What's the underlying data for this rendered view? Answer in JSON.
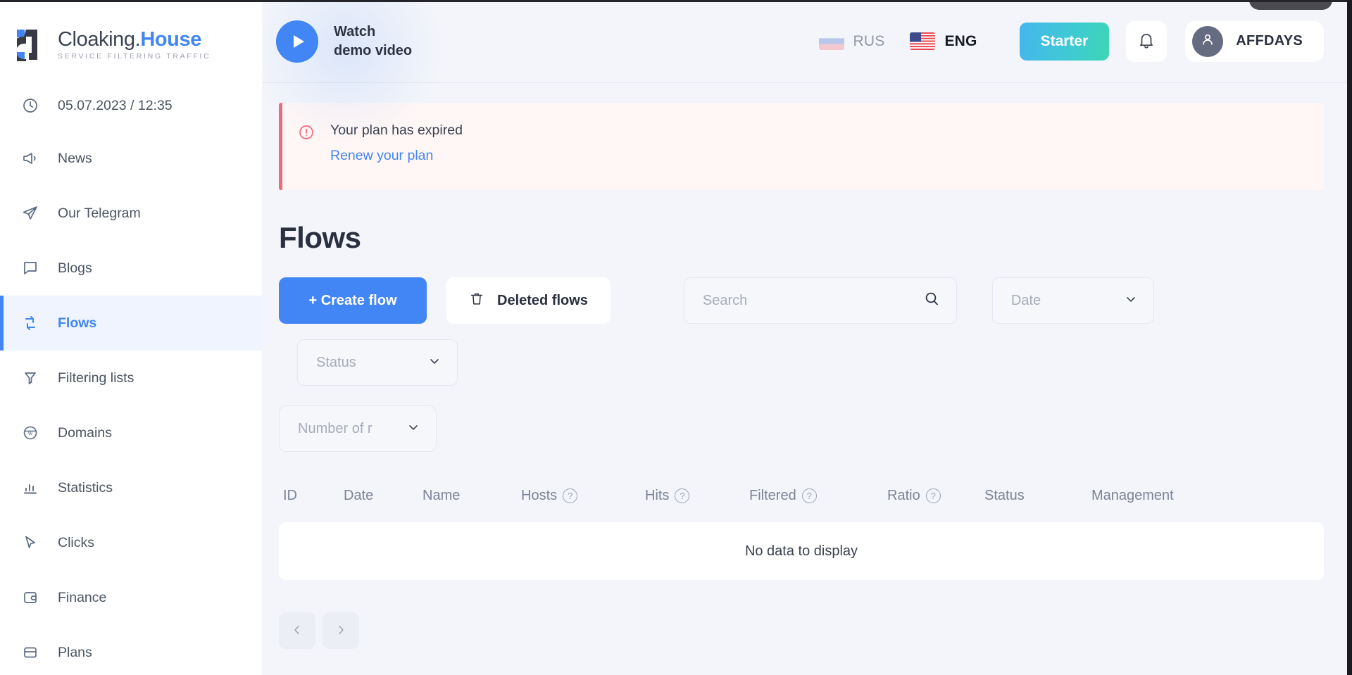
{
  "brand": {
    "name_dark": "Cloaking.",
    "name_accent": "House",
    "tagline": "SERVICE FILTERING TRAFFIC"
  },
  "sidebar": {
    "items": [
      {
        "label": "05.07.2023 / 12:35",
        "icon": "clock-icon",
        "key": "datetime",
        "active": false
      },
      {
        "label": "News",
        "icon": "megaphone-icon",
        "key": "news",
        "active": false
      },
      {
        "label": "Our Telegram",
        "icon": "send-icon",
        "key": "our-telegram",
        "active": false
      },
      {
        "label": "Blogs",
        "icon": "message-icon",
        "key": "blogs",
        "active": false
      },
      {
        "label": "Flows",
        "icon": "refresh-icon",
        "key": "flows",
        "active": true
      },
      {
        "label": "Filtering lists",
        "icon": "filter-icon",
        "key": "filtering-lists",
        "active": false
      },
      {
        "label": "Domains",
        "icon": "globe-icon",
        "key": "domains",
        "active": false
      },
      {
        "label": "Statistics",
        "icon": "bar-chart-icon",
        "key": "statistics",
        "active": false
      },
      {
        "label": "Clicks",
        "icon": "cursor-icon",
        "key": "clicks",
        "active": false
      },
      {
        "label": "Finance",
        "icon": "wallet-icon",
        "key": "finance",
        "active": false
      },
      {
        "label": "Plans",
        "icon": "card-icon",
        "key": "plans",
        "active": false
      }
    ]
  },
  "header": {
    "watch_line1": "Watch",
    "watch_line2": "demo video",
    "languages": [
      {
        "code": "RUS",
        "flag": "flag-ru",
        "active": false
      },
      {
        "code": "ENG",
        "flag": "flag-us",
        "active": true
      }
    ],
    "plan_button": "Starter",
    "notifications_icon": "bell-icon",
    "user_name": "AFFDAYS",
    "user_avatar_icon": "user-icon"
  },
  "alert": {
    "icon": "alert-circle-icon",
    "title": "Your plan has expired",
    "link": "Renew your plan"
  },
  "page": {
    "title": "Flows"
  },
  "toolbar": {
    "create_label": "+ Create flow",
    "deleted_label": "Deleted flows",
    "deleted_icon": "trash-icon",
    "search_placeholder": "Search",
    "search_value": "",
    "search_icon": "search-icon",
    "date_placeholder": "Date",
    "status_placeholder": "Status",
    "rows_placeholder": "Number of r",
    "chevron_icon": "chevron-down-icon"
  },
  "table": {
    "columns": [
      {
        "label": "ID",
        "help": false
      },
      {
        "label": "Date",
        "help": false
      },
      {
        "label": "Name",
        "help": false
      },
      {
        "label": "Hosts",
        "help": true
      },
      {
        "label": "Hits",
        "help": true
      },
      {
        "label": "Filtered",
        "help": true
      },
      {
        "label": "Ratio",
        "help": true
      },
      {
        "label": "Status",
        "help": false
      },
      {
        "label": "Management",
        "help": false
      }
    ],
    "help_glyph": "?",
    "empty_text": "No data to display",
    "rows": []
  },
  "pagination": {
    "prev_icon": "chevron-left-icon",
    "next_icon": "chevron-right-icon"
  },
  "colors": {
    "accent_blue": "#4285f4",
    "active_bg": "#eff4fe",
    "alert_red": "#f4697a",
    "alert_bg": "#fff7f6",
    "page_bg": "#f3f5fa",
    "plan_gradient_from": "#45b6ed",
    "plan_gradient_to": "#3ed6b5"
  }
}
